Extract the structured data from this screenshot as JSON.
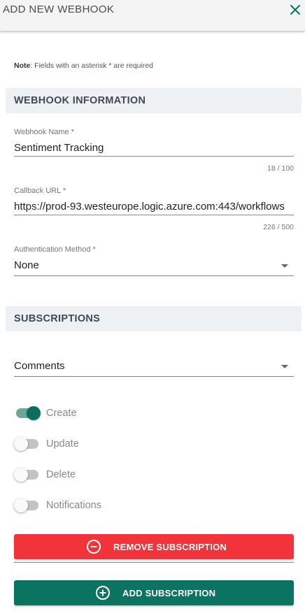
{
  "header": {
    "title": "ADD NEW WEBHOOK"
  },
  "note": {
    "label": "Note",
    "text": ": Fields with an asterisk * are required"
  },
  "webhook_info": {
    "section_title": "WEBHOOK INFORMATION",
    "name": {
      "label": "Webhook Name *",
      "value": "Sentiment Tracking",
      "counter": "18 / 100"
    },
    "callback": {
      "label": "Callback URL *",
      "value": "https://prod-93.westeurope.logic.azure.com:443/workflows",
      "counter": "226 / 500"
    },
    "auth": {
      "label": "Authentication Method *",
      "value": "None"
    }
  },
  "subscriptions": {
    "section_title": "SUBSCRIPTIONS",
    "type_value": "Comments",
    "toggles": [
      {
        "label": "Create",
        "on": true
      },
      {
        "label": "Update",
        "on": false
      },
      {
        "label": "Delete",
        "on": false
      },
      {
        "label": "Notifications",
        "on": false
      }
    ],
    "remove_label": "REMOVE SUBSCRIPTION",
    "add_label": "ADD SUBSCRIPTION"
  },
  "colors": {
    "accent_green": "#0b7460",
    "toggle_on_knob": "#0d6e5b",
    "toggle_on_track": "#6aa897",
    "danger_red": "#f2343a",
    "section_bg": "#eef1f4",
    "header_bg": "#f4f4f4"
  },
  "icons": {
    "close": "close-icon",
    "remove": "minus-circle-icon",
    "add": "plus-circle-icon"
  }
}
